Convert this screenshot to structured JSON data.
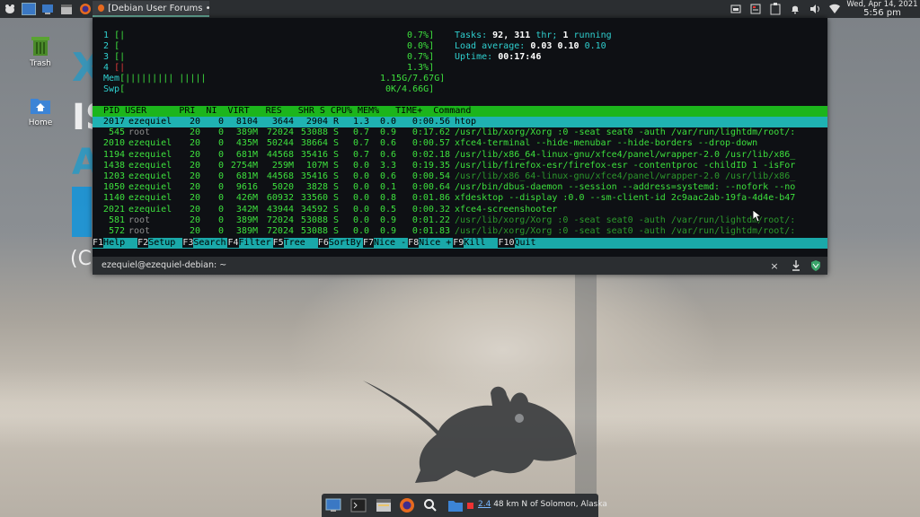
{
  "top_panel": {
    "window_button_title": "[Debian User Forums • ...",
    "clock_date": "Wed, Apr 14, 2021",
    "clock_time": "5:56 pm"
  },
  "desktop": {
    "icons": [
      {
        "label": "Trash",
        "icon": "trash-icon"
      },
      {
        "label": "Home",
        "icon": "home-folder-icon"
      }
    ],
    "wallpaper_text": [
      "XFCE",
      "IS",
      "A",
      "(Ca"
    ]
  },
  "htop": {
    "cpu_meters": [
      {
        "id": "1",
        "bar": "[|",
        "value": "0.7%]"
      },
      {
        "id": "2",
        "bar": "[",
        "value": "0.0%]"
      },
      {
        "id": "3",
        "bar": "[|",
        "value": "0.7%]"
      },
      {
        "id": "4",
        "bar": "[|",
        "value": "1.3%]"
      }
    ],
    "mem": {
      "label": "Mem",
      "bar": "[||||||||| |||||",
      "value": "1.15G/7.67G]"
    },
    "swp": {
      "label": "Swp",
      "bar": "[",
      "value": "0K/4.66G]"
    },
    "tasks_label": "Tasks:",
    "tasks_count": "92,",
    "thr_count": "311",
    "thr_label": "thr;",
    "running_count": "1",
    "running_label": "running",
    "load_label": "Load average:",
    "load_1": "0.03",
    "load_5": "0.10",
    "load_15": "0.10",
    "uptime_label": "Uptime:",
    "uptime_value": "00:17:46",
    "header": "  PID USER      PRI  NI  VIRT   RES   SHR S CPU% MEM%   TIME+  Command",
    "processes": [
      {
        "pid": "2017",
        "user": "ezequiel",
        "pri": "20",
        "ni": "0",
        "virt": "8104",
        "res": "3644",
        "shr": "2904",
        "s": "R",
        "cpu": "1.3",
        "mem": "0.0",
        "time": "0:00.56",
        "cmd": "htop",
        "style": "selected"
      },
      {
        "pid": "545",
        "user": "root",
        "pri": "20",
        "ni": "0",
        "virt": "389M",
        "res": "72024",
        "shr": "53088",
        "s": "S",
        "cpu": "0.7",
        "mem": "0.9",
        "time": "0:17.62",
        "cmd": "/usr/lib/xorg/Xorg :0 -seat seat0 -auth /var/run/lightdm/root/:",
        "style": "root"
      },
      {
        "pid": "2010",
        "user": "ezequiel",
        "pri": "20",
        "ni": "0",
        "virt": "435M",
        "res": "50244",
        "shr": "38664",
        "s": "S",
        "cpu": "0.7",
        "mem": "0.6",
        "time": "0:00.57",
        "cmd": "xfce4-terminal --hide-menubar --hide-borders --drop-down",
        "style": "user"
      },
      {
        "pid": "1194",
        "user": "ezequiel",
        "pri": "20",
        "ni": "0",
        "virt": "681M",
        "res": "44568",
        "shr": "35416",
        "s": "S",
        "cpu": "0.7",
        "mem": "0.6",
        "time": "0:02.18",
        "cmd": "/usr/lib/x86_64-linux-gnu/xfce4/panel/wrapper-2.0 /usr/lib/x86_",
        "style": "user"
      },
      {
        "pid": "1438",
        "user": "ezequiel",
        "pri": "20",
        "ni": "0",
        "virt": "2754M",
        "res": "259M",
        "shr": "107M",
        "s": "S",
        "cpu": "0.0",
        "mem": "3.3",
        "time": "0:19.35",
        "cmd": "/usr/lib/firefox-esr/firefox-esr -contentproc -childID 1 -isFor",
        "style": "user"
      },
      {
        "pid": "1203",
        "user": "ezequiel",
        "pri": "20",
        "ni": "0",
        "virt": "681M",
        "res": "44568",
        "shr": "35416",
        "s": "S",
        "cpu": "0.0",
        "mem": "0.6",
        "time": "0:00.54",
        "cmd": "/usr/lib/x86_64-linux-gnu/xfce4/panel/wrapper-2.0 /usr/lib/x86_",
        "style": "thread"
      },
      {
        "pid": "1050",
        "user": "ezequiel",
        "pri": "20",
        "ni": "0",
        "virt": "9616",
        "res": "5020",
        "shr": "3828",
        "s": "S",
        "cpu": "0.0",
        "mem": "0.1",
        "time": "0:00.64",
        "cmd": "/usr/bin/dbus-daemon --session --address=systemd: --nofork --no",
        "style": "user"
      },
      {
        "pid": "1140",
        "user": "ezequiel",
        "pri": "20",
        "ni": "0",
        "virt": "426M",
        "res": "60932",
        "shr": "33560",
        "s": "S",
        "cpu": "0.0",
        "mem": "0.8",
        "time": "0:01.86",
        "cmd": "xfdesktop --display :0.0 --sm-client-id 2c9aac2ab-19fa-4d4e-b47",
        "style": "user"
      },
      {
        "pid": "2021",
        "user": "ezequiel",
        "pri": "20",
        "ni": "0",
        "virt": "342M",
        "res": "43944",
        "shr": "34592",
        "s": "S",
        "cpu": "0.0",
        "mem": "0.5",
        "time": "0:00.32",
        "cmd": "xfce4-screenshooter",
        "style": "user"
      },
      {
        "pid": "581",
        "user": "root",
        "pri": "20",
        "ni": "0",
        "virt": "389M",
        "res": "72024",
        "shr": "53088",
        "s": "S",
        "cpu": "0.0",
        "mem": "0.9",
        "time": "0:01.22",
        "cmd": "/usr/lib/xorg/Xorg :0 -seat seat0 -auth /var/run/lightdm/root/:",
        "style": "root-thread"
      },
      {
        "pid": "572",
        "user": "root",
        "pri": "20",
        "ni": "0",
        "virt": "389M",
        "res": "72024",
        "shr": "53088",
        "s": "S",
        "cpu": "0.0",
        "mem": "0.9",
        "time": "0:01.83",
        "cmd": "/usr/lib/xorg/Xorg :0 -seat seat0 -auth /var/run/lightdm/root/:",
        "style": "root-thread"
      }
    ],
    "fkeys": [
      {
        "key": "F1",
        "label": "Help  "
      },
      {
        "key": "F2",
        "label": "Setup "
      },
      {
        "key": "F3",
        "label": "Search"
      },
      {
        "key": "F4",
        "label": "Filter"
      },
      {
        "key": "F5",
        "label": "Tree  "
      },
      {
        "key": "F6",
        "label": "SortBy"
      },
      {
        "key": "F7",
        "label": "Nice -"
      },
      {
        "key": "F8",
        "label": "Nice +"
      },
      {
        "key": "F9",
        "label": "Kill  "
      },
      {
        "key": "F10",
        "label": "Quit  "
      }
    ]
  },
  "terminal": {
    "title": "ezequiel@ezequiel-debian: ~",
    "close_glyph": "×"
  },
  "dock": {
    "weather_temp": "2.4",
    "weather_text": "48 km N of Solomon, Alaska"
  },
  "colors": {
    "htop_green": "#3de03d",
    "htop_cyan": "#2fd0d0",
    "panel_bg": "#2b2e31"
  }
}
